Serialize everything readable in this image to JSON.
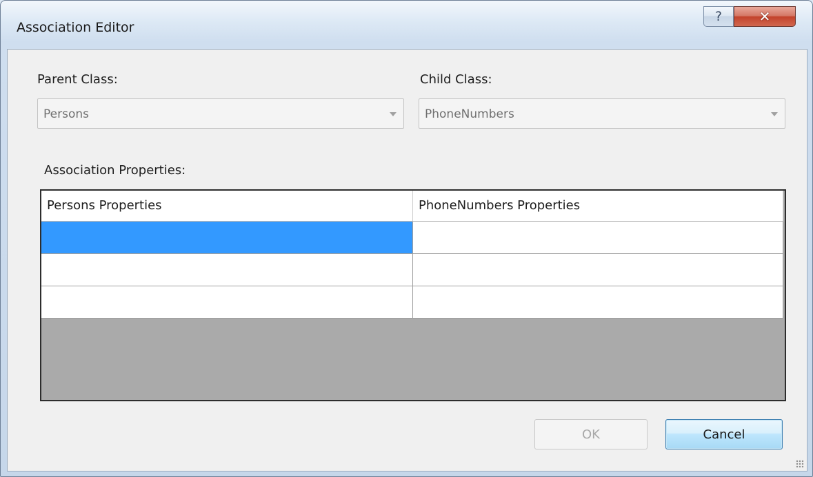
{
  "window": {
    "title": "Association Editor",
    "help_glyph": "?",
    "close_glyph": "✕"
  },
  "parent": {
    "label": "Parent Class:",
    "value": "Persons"
  },
  "child": {
    "label": "Child Class:",
    "value": "PhoneNumbers"
  },
  "association": {
    "label": "Association Properties:",
    "columns": [
      "Persons Properties",
      "PhoneNumbers Properties"
    ],
    "rows": [
      [
        "",
        ""
      ],
      [
        "",
        ""
      ],
      [
        "",
        ""
      ]
    ],
    "selected_row": 0,
    "selected_col": 0
  },
  "buttons": {
    "ok": "OK",
    "cancel": "Cancel"
  },
  "colors": {
    "selection": "#3399ff",
    "empty_grid_area": "#aaaaaa",
    "close_button": "#c3432c"
  }
}
